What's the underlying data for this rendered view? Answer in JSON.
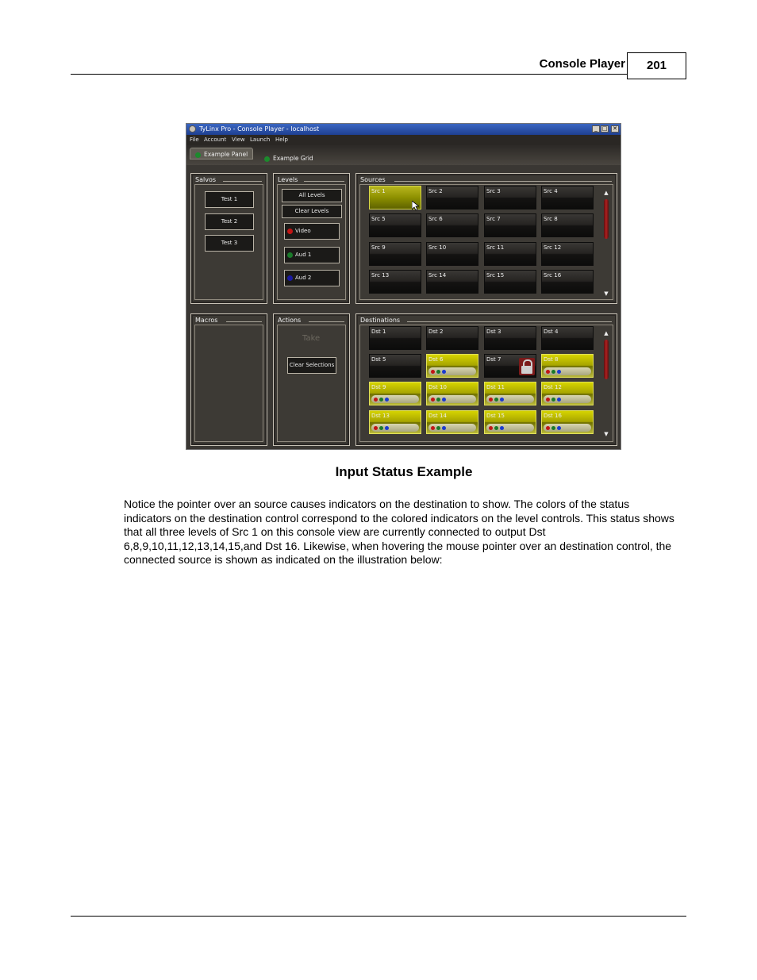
{
  "header": {
    "title": "Console Player",
    "page_number": "201"
  },
  "window": {
    "title": "TyLinx Pro - Console Player - localhost",
    "controls": [
      "_",
      "□",
      "✕"
    ],
    "menu": [
      "File",
      "Account",
      "View",
      "Launch",
      "Help"
    ],
    "tabs": [
      "Example Panel",
      "Example Grid"
    ],
    "salvos": {
      "title": "Salvos",
      "buttons": [
        "Test 1",
        "Test 2",
        "Test 3"
      ]
    },
    "levels": {
      "title": "Levels",
      "buttons": [
        "All Levels",
        "Clear Levels"
      ],
      "items": [
        {
          "label": "Video",
          "color": "#c21515"
        },
        {
          "label": "Aud 1",
          "color": "#1a7a2a"
        },
        {
          "label": "Aud 2",
          "color": "#1a1aa0"
        }
      ]
    },
    "sources": {
      "title": "Sources",
      "items": [
        "Src 1",
        "Src 2",
        "Src 3",
        "Src 4",
        "Src 5",
        "Src 6",
        "Src 7",
        "Src 8",
        "Src 9",
        "Src 10",
        "Src 11",
        "Src 12",
        "Src 13",
        "Src 14",
        "Src 15",
        "Src 16"
      ]
    },
    "macros": {
      "title": "Macros"
    },
    "actions": {
      "title": "Actions",
      "take": "Take",
      "clear_selections": "Clear Selections"
    },
    "destinations": {
      "title": "Destinations",
      "items": [
        "Dst 1",
        "Dst 2",
        "Dst 3",
        "Dst 4",
        "Dst 5",
        "Dst 6",
        "Dst 7",
        "Dst 8",
        "Dst 9",
        "Dst 10",
        "Dst 11",
        "Dst 12",
        "Dst 13",
        "Dst 14",
        "Dst 15",
        "Dst 16"
      ]
    },
    "colors": {
      "active": "#c6c400",
      "indicator_red": "#c21515",
      "indicator_green": "#1a7a2a",
      "indicator_blue": "#1a3ad0"
    }
  },
  "caption": "Input Status Example",
  "body": "Notice the pointer over an source causes indicators on the destination to show. The colors of the status indicators on the destination control correspond to the colored indicators on the level controls. This status shows that all three levels of Src 1 on this console view are currently connected to output Dst 6,8,9,10,11,12,13,14,15,and Dst 16. Likewise, when hovering the mouse pointer over an destination control, the connected source is shown as indicated on the illustration below:"
}
